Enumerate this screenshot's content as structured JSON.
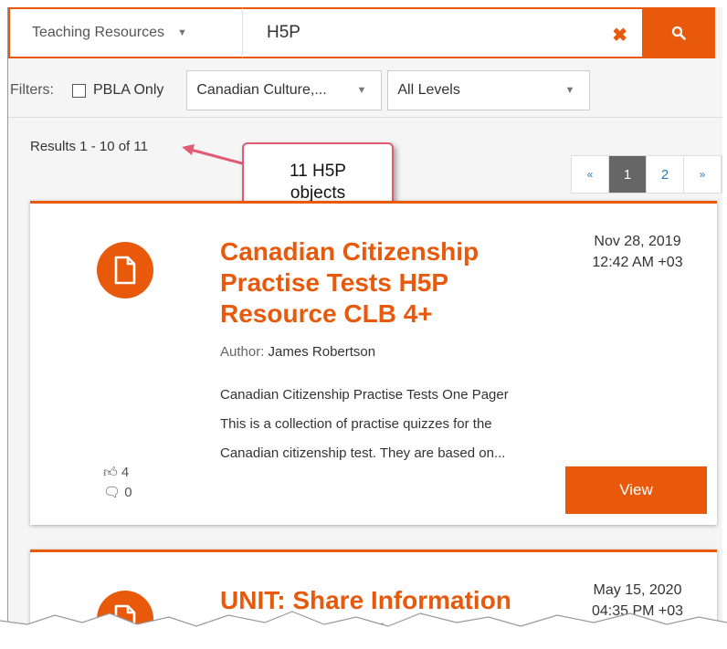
{
  "search": {
    "category": "Teaching Resources",
    "query": "H5P"
  },
  "filters": {
    "label": "Filters:",
    "pbla_label": "PBLA Only",
    "topic_value": "Canadian Culture,...",
    "level_value": "All Levels"
  },
  "results_text": "Results 1 - 10 of 11",
  "annotation": {
    "line1": "11 H5P",
    "line2": "objects"
  },
  "pagination": {
    "prev": "«",
    "pages": [
      "1",
      "2"
    ],
    "next": "»",
    "current": "1"
  },
  "results": [
    {
      "title": "Canadian Citizenship Practise Tests H5P Resource CLB 4+",
      "date": "Nov 28, 2019",
      "time": "12:42 AM +03",
      "author_label": "Author:",
      "author": "James Robertson",
      "description": "Canadian Citizenship Practise Tests One Pager This is a collection of practise quizzes for the Canadian citizenship test. They are based on...",
      "likes": "4",
      "comments": "0",
      "view_label": "View"
    },
    {
      "title": "UNIT: Share Information About the Future CLB",
      "date": "May 15, 2020",
      "time": "04:35 PM +03"
    }
  ],
  "colors": {
    "accent": "#e8590c",
    "callout_border": "#e05b72"
  }
}
